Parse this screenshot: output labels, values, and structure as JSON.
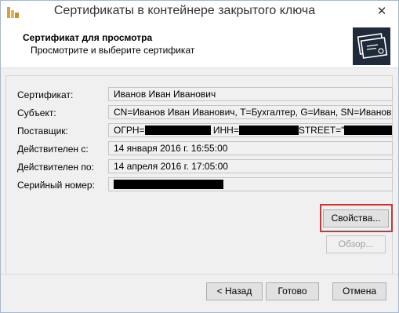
{
  "window": {
    "title": "Сертификаты в контейнере закрытого ключа",
    "close_glyph": "✕"
  },
  "header": {
    "title": "Сертификат для просмотра",
    "subtitle": "Просмотрите и выберите сертификат"
  },
  "fields": {
    "certificate": {
      "label": "Сертификат:",
      "value": "Иванов Иван Иванович"
    },
    "subject": {
      "label": "Субъект:",
      "value": "CN=Иванов Иван Иванович, T=Бухгалтер, G=Иван, SN=Иванов"
    },
    "issuer": {
      "label": "Поставщик:",
      "part1": "ОГРН=",
      "part2": "ИНН=",
      "part3": "STREET=\""
    },
    "valid_from": {
      "label": "Действителен с:",
      "value": "14 января 2016 г.  16:55:00"
    },
    "valid_to": {
      "label": "Действителен по:",
      "value": "14 апреля 2016 г.  17:05:00"
    },
    "serial": {
      "label": "Серийный номер:"
    }
  },
  "buttons": {
    "properties": "Свойства...",
    "browse": "Обзор...",
    "back": "< Назад",
    "finish": "Готово",
    "cancel": "Отмена"
  },
  "colors": {
    "highlight": "#c0393b",
    "icon_bg": "#1f2a3a"
  },
  "icons": {
    "app": "crypto-pro-icon",
    "header": "certificate-icon",
    "close": "close-icon"
  }
}
